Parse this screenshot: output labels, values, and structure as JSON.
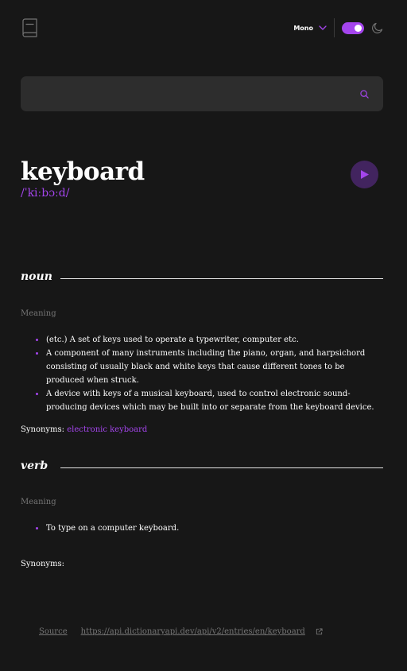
{
  "header": {
    "logo_icon": "book-icon",
    "font_select_label": "Mono",
    "theme_toggle_on": true,
    "moon_icon": "moon-icon"
  },
  "search": {
    "value": "",
    "placeholder": "",
    "icon": "search-icon"
  },
  "entry": {
    "word": "keyboard",
    "phonetic": "/ˈkiːbɔːd/",
    "play_icon": "play-icon"
  },
  "meanings": [
    {
      "part_of_speech": "noun",
      "meaning_label": "Meaning",
      "definitions": [
        "(etc.) A set of keys used to operate a typewriter, computer etc.",
        "A component of many instruments including the piano, organ, and harpsichord consisting of usually black and white keys that cause different tones to be produced when struck.",
        "A device with keys of a musical keyboard, used to control electronic sound-producing devices which may be built into or separate from the keyboard device."
      ],
      "synonyms_label": "Synonyms:",
      "synonyms": [
        "electronic keyboard"
      ]
    },
    {
      "part_of_speech": "verb",
      "meaning_label": "Meaning",
      "definitions": [
        "To type on a computer keyboard."
      ],
      "synonyms_label": "Synonyms:",
      "synonyms": []
    }
  ],
  "footer": {
    "source_label": "Source",
    "source_url": "https://api.dictionaryapi.dev/api/v2/entries/en/keyboard",
    "external_icon": "external-link-icon"
  },
  "colors": {
    "accent": "#a445ed",
    "background": "#171717",
    "search_background": "#2d2d2d",
    "muted_text": "#757575"
  }
}
